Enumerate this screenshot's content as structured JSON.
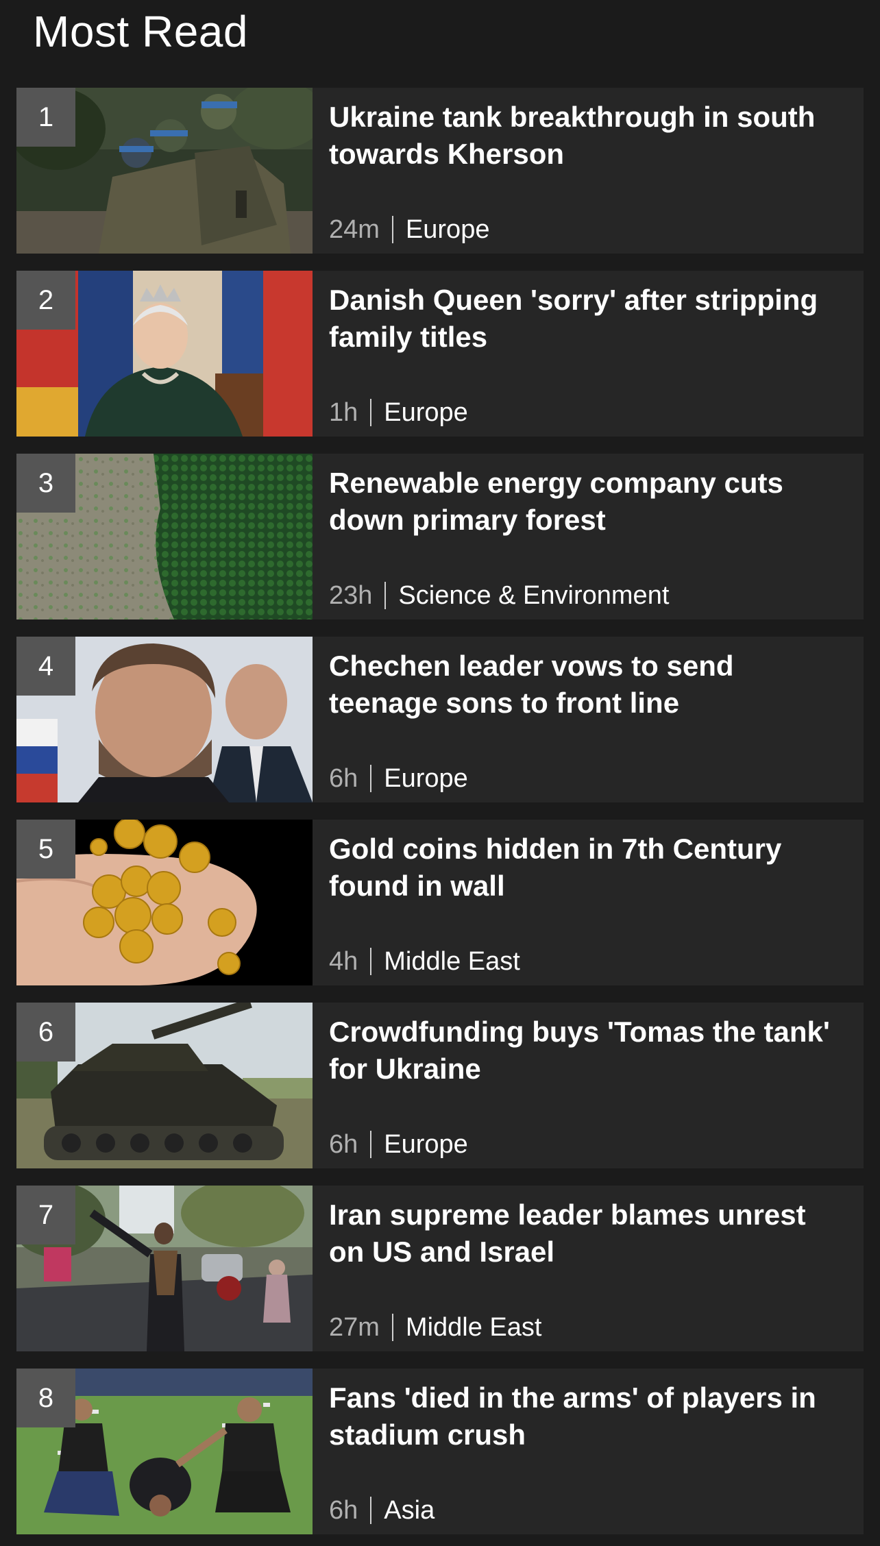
{
  "header": {
    "title": "Most Read"
  },
  "items": [
    {
      "rank": "1",
      "headline": "Ukraine tank breakthrough in south towards Kherson",
      "time": "24m",
      "section": "Europe",
      "image": "soldiers-photo"
    },
    {
      "rank": "2",
      "headline": "Danish Queen 'sorry' after stripping family titles",
      "time": "1h",
      "section": "Europe",
      "image": "queen-photo"
    },
    {
      "rank": "3",
      "headline": "Renewable energy company cuts down primary forest",
      "time": "23h",
      "section": "Science & Environment",
      "image": "forest-aerial-photo"
    },
    {
      "rank": "4",
      "headline": "Chechen leader vows to send teenage sons to front line",
      "time": "6h",
      "section": "Europe",
      "image": "chechen-leader-photo"
    },
    {
      "rank": "5",
      "headline": "Gold coins hidden in 7th Century found in wall",
      "time": "4h",
      "section": "Middle East",
      "image": "gold-coins-photo"
    },
    {
      "rank": "6",
      "headline": "Crowdfunding buys 'Tomas the tank' for Ukraine",
      "time": "6h",
      "section": "Europe",
      "image": "tank-photo"
    },
    {
      "rank": "7",
      "headline": "Iran supreme leader blames unrest on US and Israel",
      "time": "27m",
      "section": "Middle East",
      "image": "protest-street-photo"
    },
    {
      "rank": "8",
      "headline": "Fans 'died in the arms' of players in stadium crush",
      "time": "6h",
      "section": "Asia",
      "image": "stadium-players-photo"
    }
  ]
}
